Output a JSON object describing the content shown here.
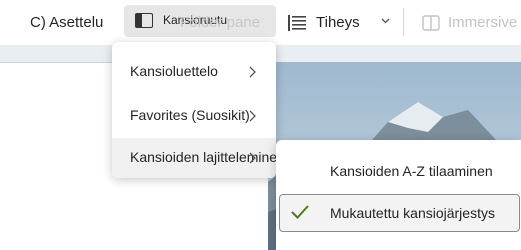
{
  "toolbar": {
    "settings_label": "C) Asettelu",
    "folder_pane_label": "Kansioruutu",
    "folder_pane_ghost_label": "Folder pane",
    "density_label": "Tiheys",
    "immersive_label": "Immersive"
  },
  "folder_pane_menu": {
    "items": [
      {
        "label": "Kansioluettelo",
        "has_submenu": true
      },
      {
        "label": "Favorites (Suosikit)",
        "has_submenu": true
      },
      {
        "label": "Kansioiden lajitteleminen",
        "has_submenu": true,
        "active": true
      }
    ]
  },
  "sort_submenu": {
    "items": [
      {
        "label": "Kansioiden A-Z tilaaminen",
        "checked": false
      },
      {
        "label": "Mukautettu kansiojärjestys",
        "checked": true
      }
    ]
  },
  "colors": {
    "accent_check": "#4a7c1f",
    "selected_button_bg": "#e6e6e6"
  }
}
